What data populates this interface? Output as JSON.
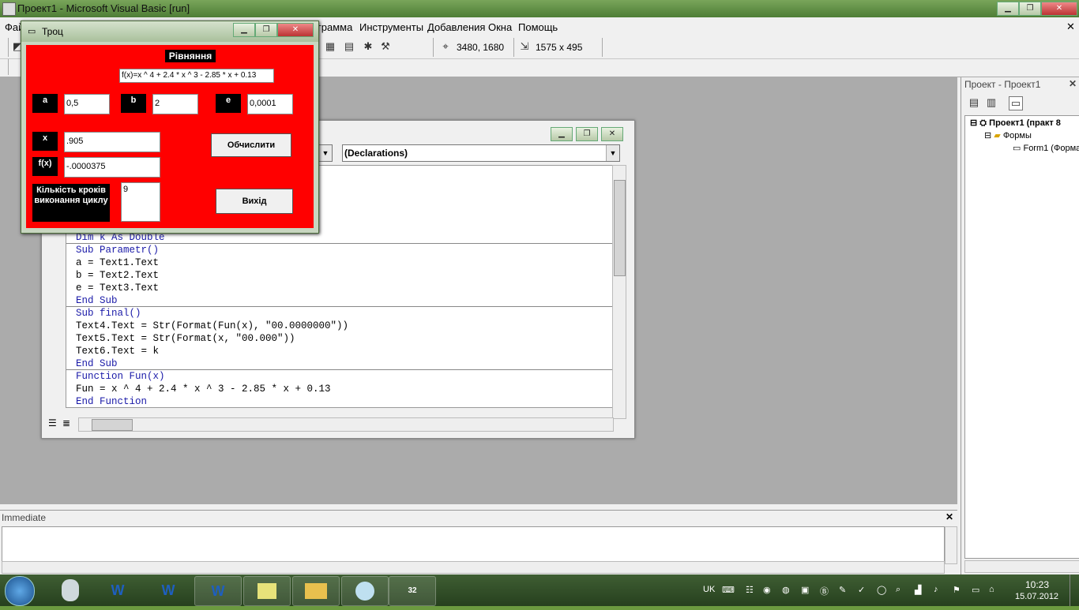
{
  "window": {
    "title": "Проект1 - Microsoft Visual Basic [run]"
  },
  "menu": {
    "file_partial": "Фай",
    "items": [
      "грамма",
      "Инструменты",
      "Добавления",
      "Окна",
      "Помощь"
    ]
  },
  "toolbar": {
    "position": "3480, 1680",
    "size": "1575 x 495"
  },
  "project": {
    "header": "Проект - Проект1",
    "root": "Проект1 (практ 8",
    "folder": "Формы",
    "form": "Form1 (Форма"
  },
  "immediate": {
    "header": "Immediate"
  },
  "code": {
    "object_combo": "",
    "proc_combo": "(Declarations)",
    "lines_block1": [
      "Dim k As Double"
    ],
    "lines_block2": [
      "Sub Parametr()",
      "a = Text1.Text",
      "b = Text2.Text",
      "e = Text3.Text",
      "End Sub"
    ],
    "lines_block3": [
      "Sub final()",
      "Text4.Text = Str(Format(Fun(x), \"00.0000000\"))",
      "Text5.Text = Str(Format(x, \"00.000\"))",
      "Text6.Text = k",
      "End Sub"
    ],
    "lines_block4": [
      "Function Fun(x)",
      "Fun = x ^ 4 + 2.4 * x ^ 3 - 2.85 * x + 0.13",
      "End Function"
    ]
  },
  "form": {
    "title": "Троц",
    "heading": "Рівняння",
    "equation": "f(x)=x ^ 4 + 2.4 * x ^ 3 - 2.85 * x + 0.13",
    "label_a": "a",
    "value_a": "0,5",
    "label_b": "b",
    "value_b": "2",
    "label_e": "e",
    "value_e": "0,0001",
    "label_x": "x",
    "value_x": ".905",
    "label_fx": "f(x)",
    "value_fx": "-.0000375",
    "label_steps": "Кількість кроків виконання циклу",
    "value_steps": "9",
    "btn_compute": "Обчислити",
    "btn_exit": "Вихід"
  },
  "taskbar": {
    "lang": "UK",
    "time": "10:23",
    "date": "15.07.2012",
    "apps": [
      "W",
      "W",
      "W",
      "",
      "",
      "",
      "32"
    ]
  }
}
